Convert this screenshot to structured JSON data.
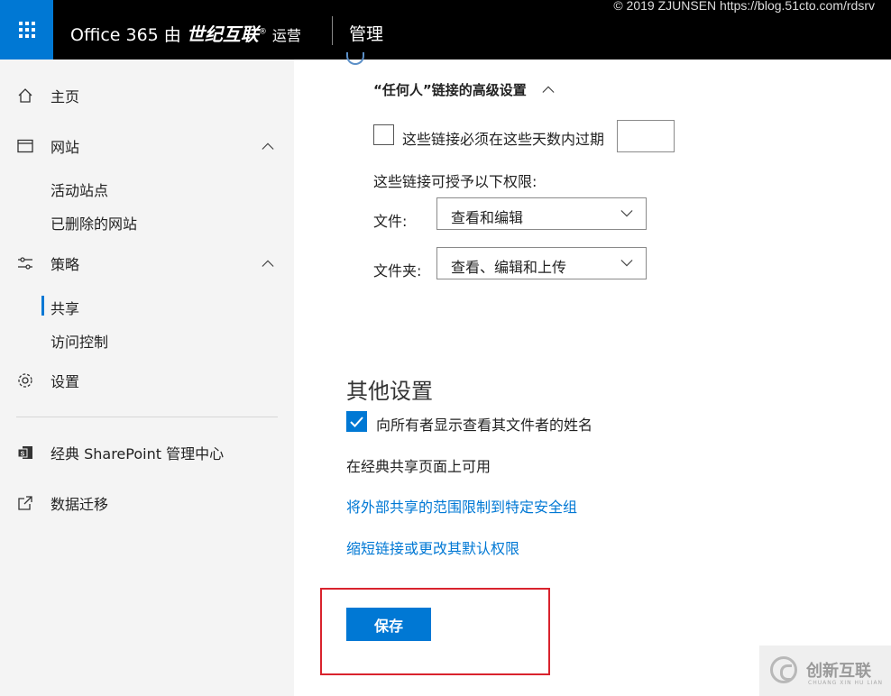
{
  "header": {
    "brand_prefix": "Office 365 由",
    "brand_name": "世纪互联",
    "brand_mark": "®",
    "brand_suffix": "运营",
    "section": "管理",
    "watermark": "© 2019 ZJUNSEN https://blog.51cto.com/rdsrv"
  },
  "sidebar": {
    "home": "主页",
    "sites": "网站",
    "active_sites": "活动站点",
    "deleted_sites": "已删除的网站",
    "policies": "策略",
    "sharing": "共享",
    "access_control": "访问控制",
    "settings": "设置",
    "classic_admin": "经典 SharePoint 管理中心",
    "migration": "数据迁移"
  },
  "anyone_links": {
    "heading": "“任何人”链接的高级设置",
    "expire_label": "这些链接必须在这些天数内过期",
    "expire_checked": false,
    "expire_days": "",
    "permissions_intro": "这些链接可授予以下权限:",
    "files_label": "文件:",
    "files_value": "查看和编辑",
    "folders_label": "文件夹:",
    "folders_value": "查看、编辑和上传"
  },
  "other_settings": {
    "title": "其他设置",
    "show_owner_label": "向所有者显示查看其文件者的姓名",
    "show_owner_checked": true,
    "classic_note": "在经典共享页面上可用",
    "link_limit_groups": "将外部共享的范围限制到特定安全组",
    "link_shorten": "缩短链接或更改其默认权限"
  },
  "actions": {
    "save": "保存"
  },
  "corner_logo": {
    "cn": "创新互联",
    "en": "CHUANG XIN HU LIAN"
  },
  "colors": {
    "accent": "#0078d4",
    "header_bg": "#000000",
    "sidebar_bg": "#f4f4f4",
    "highlight": "#d9232d"
  }
}
